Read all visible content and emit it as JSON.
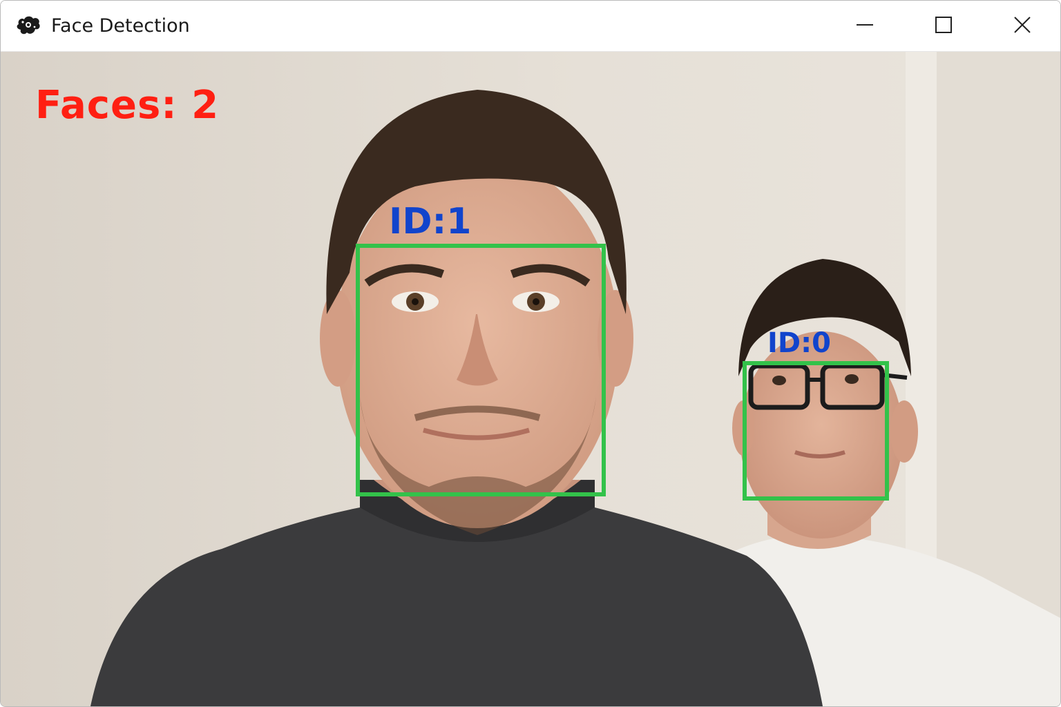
{
  "window": {
    "title": "Face Detection",
    "app_icon": "camera-blob-icon",
    "controls": {
      "minimize_icon": "minimize-icon",
      "maximize_icon": "maximize-icon",
      "close_icon": "close-icon"
    }
  },
  "overlay": {
    "face_count_text": "Faces: 2",
    "count_color": "#ff1f12",
    "box_color": "#33c24a",
    "label_color": "#1144cc"
  },
  "faces": [
    {
      "id_label": "ID:1"
    },
    {
      "id_label": "ID:0"
    }
  ]
}
